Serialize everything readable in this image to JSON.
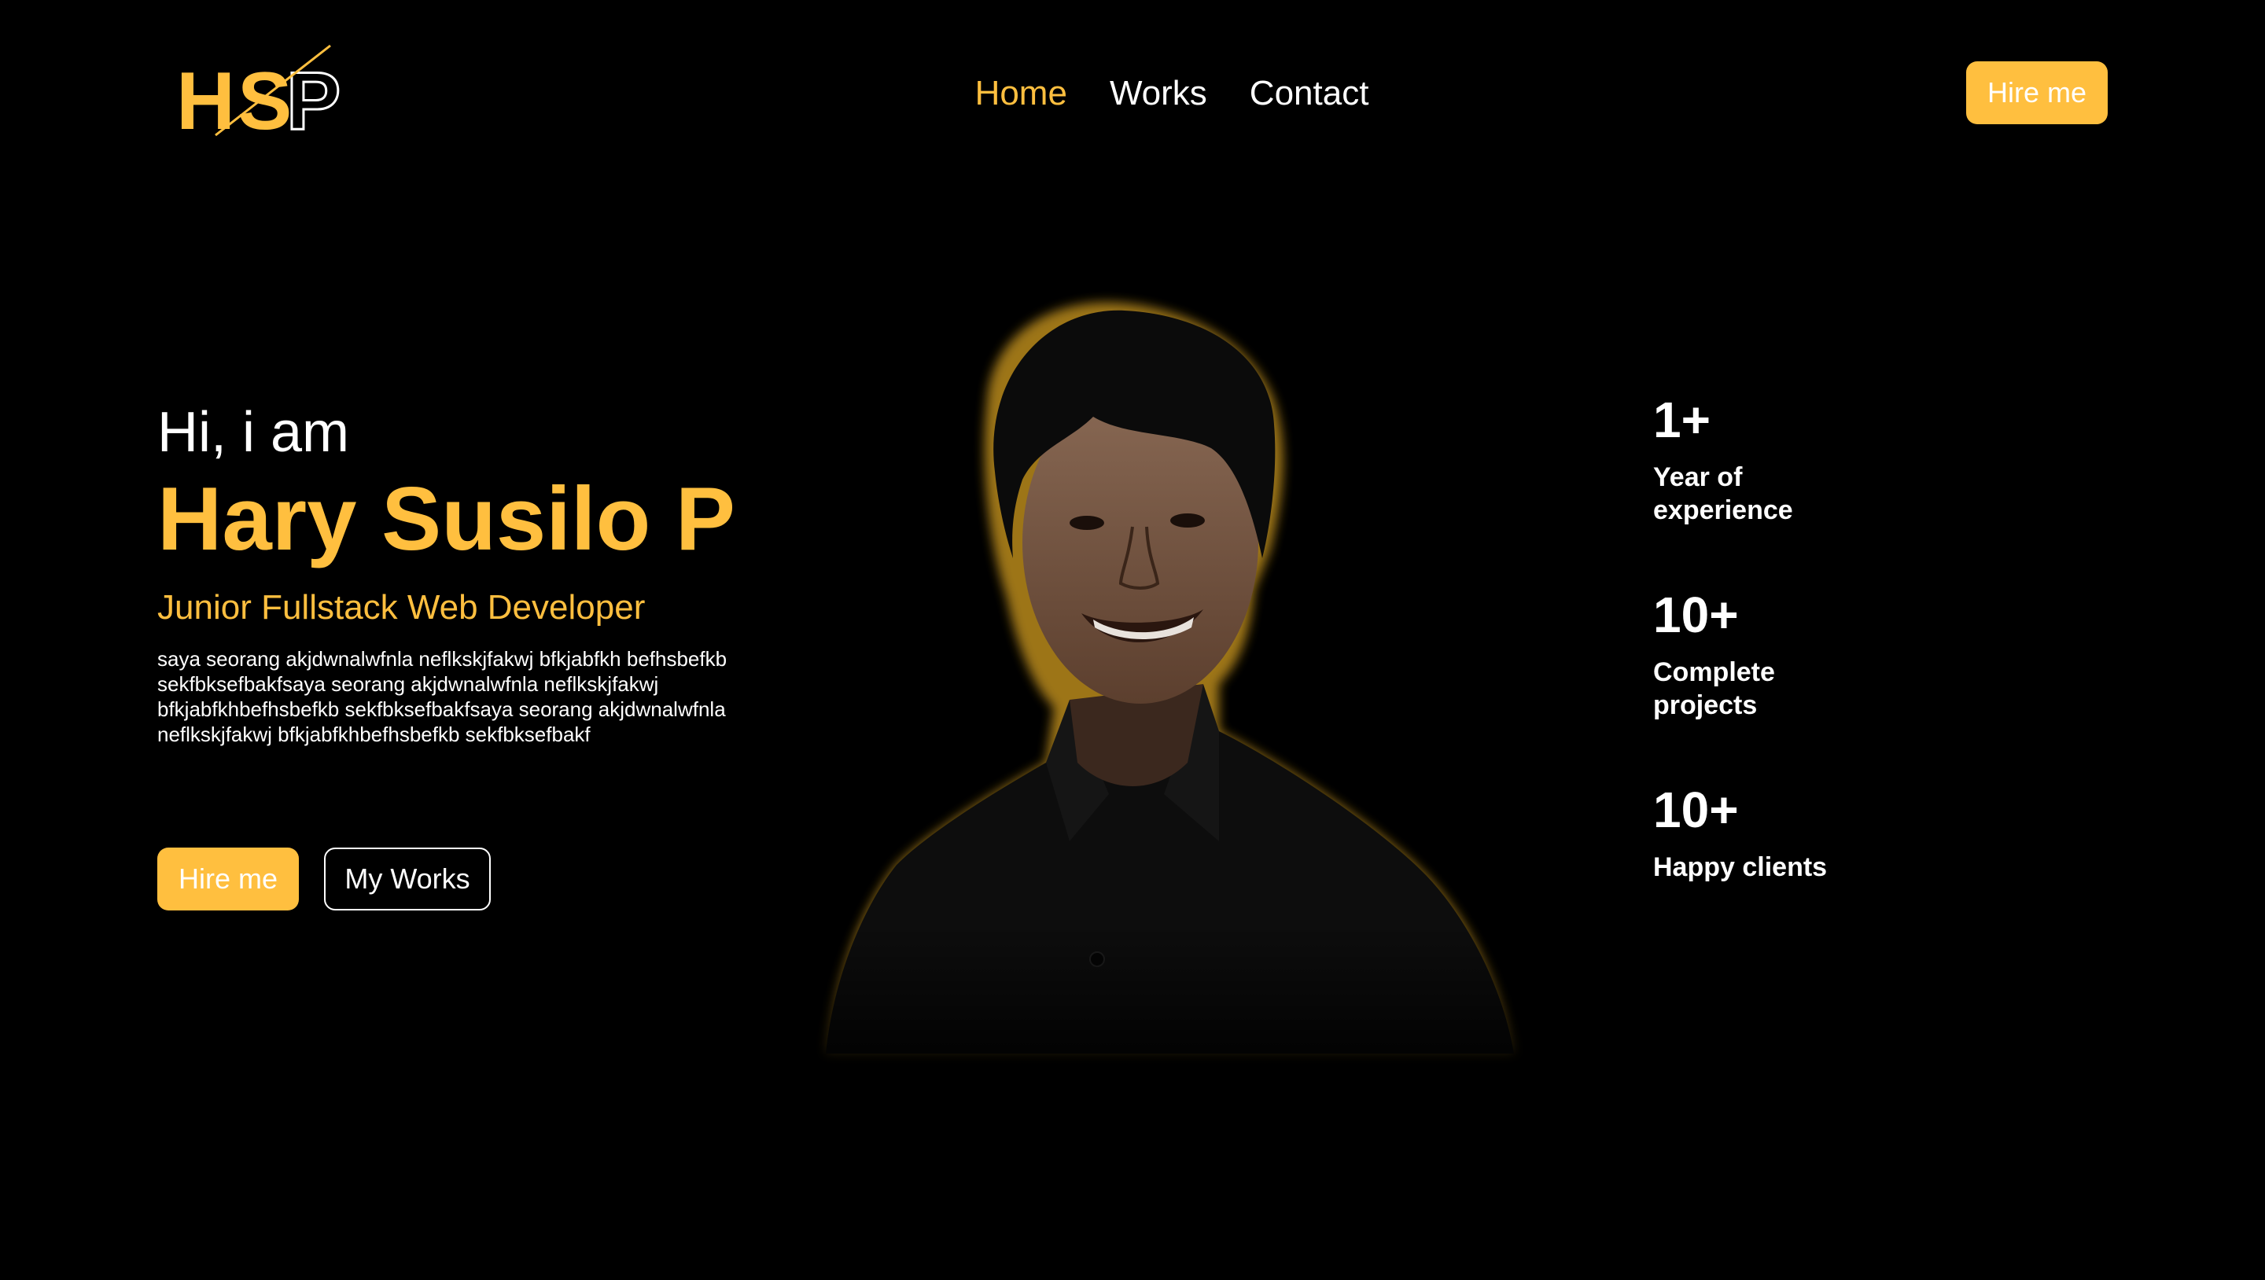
{
  "brand": {
    "logo_text": "HSP",
    "accent": "#ffbf3f"
  },
  "nav": {
    "items": [
      {
        "label": "Home",
        "active": true
      },
      {
        "label": "Works",
        "active": false
      },
      {
        "label": "Contact",
        "active": false
      }
    ],
    "hire_label": "Hire me"
  },
  "hero": {
    "greeting": "Hi, i am",
    "name": "Hary Susilo P",
    "role": "Junior Fullstack Web Developer",
    "bio": "saya seorang akjdwnalwfnla neflkskjfakwj bfkjabfkh befhsbefkb sekfbksefbakfsaya seorang akjdwnalwfnla neflkskjfakwj bfkjabfkhbefhsbefkb sekfbksefbakfsaya seorang akjdwnalwfnla neflkskjfakwj bfkjabfkhbefhsbefkb sekfbksefbakf",
    "primary_button": "Hire me",
    "secondary_button": "My Works"
  },
  "stats": [
    {
      "value": "1+",
      "label": "Year of experience"
    },
    {
      "value": "10+",
      "label": "Complete projects"
    },
    {
      "value": "10+",
      "label": "Happy clients"
    }
  ]
}
